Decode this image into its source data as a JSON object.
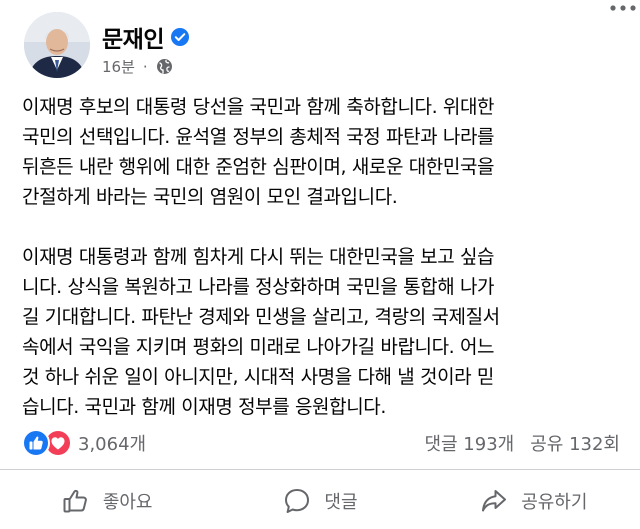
{
  "post": {
    "author_name": "문재인",
    "timestamp": "16분",
    "meta_separator": "·",
    "body_lines": [
      "이재명 후보의 대통령 당선을 국민과 함께 축하합니다. 위대한",
      "국민의 선택입니다. 윤석열 정부의 총체적 국정 파탄과 나라를",
      "뒤흔든 내란 행위에 대한 준엄한 심판이며, 새로운 대한민국을",
      "간절하게 바라는 국민의 염원이 모인 결과입니다.",
      "",
      "이재명 대통령과 함께 힘차게 다시 뛰는 대한민국을 보고 싶습",
      "니다. 상식을 복원하고 나라를 정상화하며 국민을 통합해 나가",
      "길 기대합니다. 파탄난 경제와 민생을 살리고, 격랑의 국제질서",
      "속에서 국익을 지키며 평화의 미래로 나아가길 바랍니다. 어느",
      "것 하나 쉬운 일이 아니지만, 시대적 사명을 다해 낼 것이라 믿",
      "습니다. 국민과 함께 이재명 정부를 응원합니다."
    ]
  },
  "stats": {
    "reaction_count": "3,064개",
    "comments": "댓글 193개",
    "shares": "공유 132회"
  },
  "actions": {
    "like_label": "좋아요",
    "comment_label": "댓글",
    "share_label": "공유하기"
  },
  "colors": {
    "primary_text": "#050505",
    "secondary_text": "#65676b",
    "like_blue": "#1877f2",
    "love_red": "#f33e58",
    "divider": "#ced0d4"
  },
  "icons": [
    "avatar",
    "verified-badge-icon",
    "globe-icon",
    "more-options-icon",
    "like-reaction-icon",
    "love-reaction-icon",
    "thumbs-up-icon",
    "comment-icon",
    "share-icon"
  ]
}
